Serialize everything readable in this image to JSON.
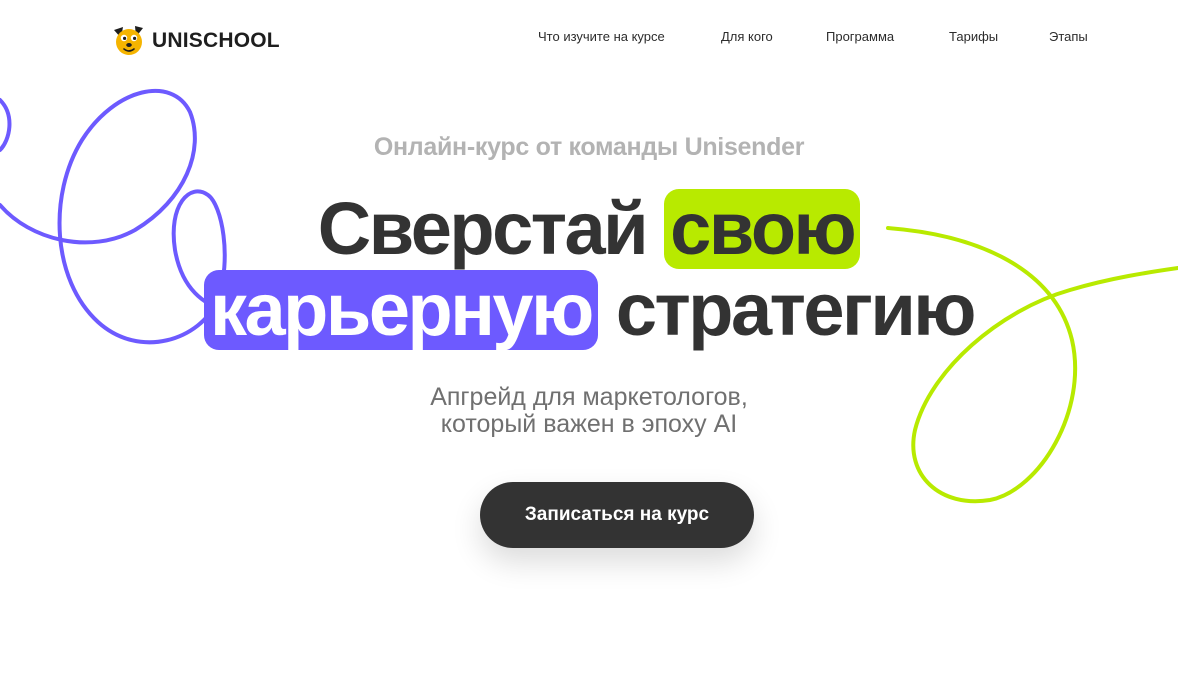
{
  "brand": {
    "name": "UNISCHOOL",
    "mascot_icon": "dog-mascot-icon",
    "mascot_color": "#f5b400"
  },
  "nav": {
    "items": [
      {
        "label": "Что изучите на курсе"
      },
      {
        "label": "Для кого"
      },
      {
        "label": "Программа"
      },
      {
        "label": "Тарифы"
      },
      {
        "label": "Этапы"
      }
    ]
  },
  "hero": {
    "subtitle": "Онлайн-курс от команды Unisender",
    "headline": {
      "word1": "Сверстай",
      "word2_highlight": "свою",
      "word3_highlight": "карьерную",
      "word4": "стратегию"
    },
    "description": {
      "line1": "Апгрейд для маркетологов,",
      "line2": "который важен в эпоху AI"
    },
    "cta_label": "Записаться на курс"
  },
  "colors": {
    "accent_green": "#b8ea00",
    "accent_purple": "#6d5aff",
    "text_dark": "#333333",
    "cta_background": "#333333"
  }
}
